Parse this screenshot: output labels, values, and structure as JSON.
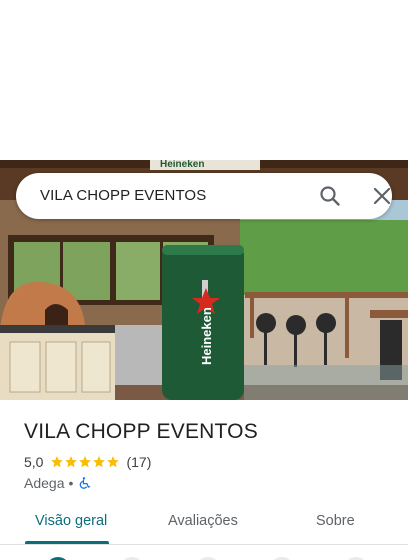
{
  "search": {
    "query": "VILA CHOPP EVENTOS"
  },
  "photo": {
    "description_icon": "place-photo",
    "sign_text": "Heineken",
    "tap_brand_text": "Heineken"
  },
  "place": {
    "name": "VILA CHOPP EVENTOS",
    "rating": "5,0",
    "stars": 5,
    "review_count": "(17)",
    "category": "Adega",
    "separator": "•",
    "accessibility_icon": "wheelchair-icon"
  },
  "tabs": [
    {
      "label": "Visão geral",
      "active": true
    },
    {
      "label": "Avaliações",
      "active": false
    },
    {
      "label": "Sobre",
      "active": false
    }
  ],
  "colors": {
    "accent": "#0b6e7c",
    "star": "#fbbc04",
    "wheelchair": "#1a73e8",
    "tap_green": "#1e5a36"
  }
}
